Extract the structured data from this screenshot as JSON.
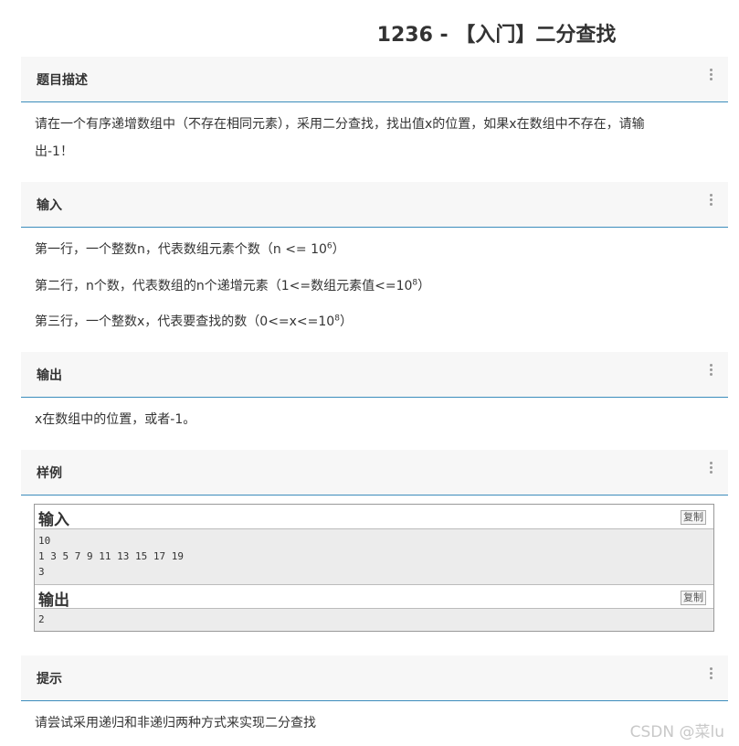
{
  "page_title": "1236 - 【入门】二分查找",
  "sections": {
    "description": {
      "label": "题目描述",
      "text_line1": "请在一个有序递增数组中（不存在相同元素），采用二分查找，找出值x的位置，如果x在数组中不存在，请输",
      "text_line2": "出-1！"
    },
    "input": {
      "label": "输入",
      "line1_text": "第一行，一个整数n，代表数组元素个数（n <= 10",
      "line1_sup": "6",
      "line1_end": "）",
      "line2_text": "第二行，n个数，代表数组的n个递增元素（1<=数组元素值<=10",
      "line2_sup": "8",
      "line2_end": "）",
      "line3_text": "第三行，一个整数x，代表要查找的数（0<=x<=10",
      "line3_sup": "8",
      "line3_end": "）"
    },
    "output": {
      "label": "输出",
      "text": "x在数组中的位置，或者-1。"
    },
    "sample": {
      "label": "样例",
      "input_title": "输入",
      "input_copy": "复制",
      "input_lines": [
        "10",
        "1 3 5 7 9 11 13 15 17 19",
        "3"
      ],
      "output_title": "输出",
      "output_copy": "复制",
      "output_lines": [
        "2"
      ]
    },
    "hint": {
      "label": "提示",
      "text": "请尝试采用递归和非递归两种方式来实现二分查找"
    }
  },
  "watermark": "CSDN @菜lu"
}
